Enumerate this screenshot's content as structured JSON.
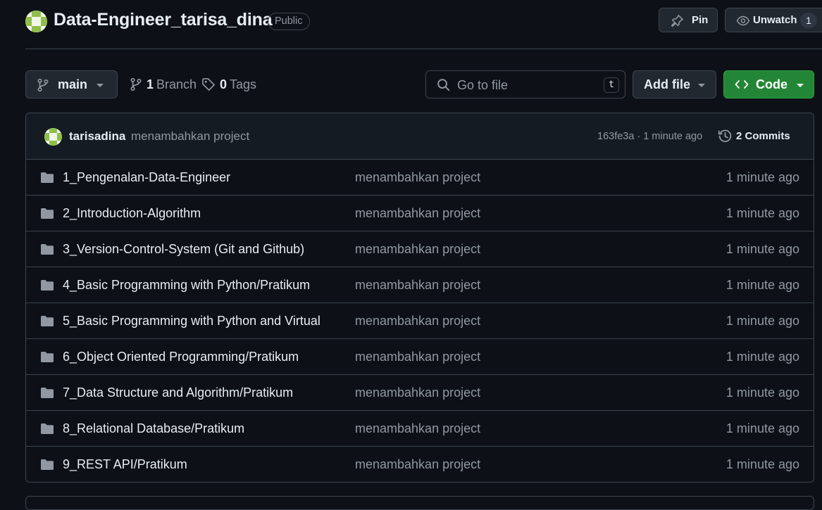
{
  "repo": {
    "name": "Data-Engineer_tarisa_dina",
    "visibility": "Public",
    "pin_label": "Pin",
    "watch_label": "Unwatch",
    "watch_count": "1"
  },
  "toolbar": {
    "branch": "main",
    "branches_count": "1",
    "branches_label": "Branch",
    "tags_count": "0",
    "tags_label": "Tags",
    "search_placeholder": "Go to file",
    "search_shortcut": "t",
    "add_file_label": "Add file",
    "code_label": "Code"
  },
  "latest_commit": {
    "author": "tarisadina",
    "message": "menambahkan project",
    "hash_time": "163fe3a · 1 minute ago",
    "commits_label": "2 Commits"
  },
  "files": [
    {
      "name": "1_Pengenalan-Data-Engineer",
      "message": "menambahkan project",
      "time": "1 minute ago"
    },
    {
      "name": "2_Introduction-Algorithm",
      "message": "menambahkan project",
      "time": "1 minute ago"
    },
    {
      "name": "3_Version-Control-System (Git and Github)",
      "message": "menambahkan project",
      "time": "1 minute ago"
    },
    {
      "name": "4_Basic Programming with Python/Pratikum",
      "message": "menambahkan project",
      "time": "1 minute ago"
    },
    {
      "name": "5_Basic Programming with Python and Virtual ...",
      "message": "menambahkan project",
      "time": "1 minute ago"
    },
    {
      "name": "6_Object Oriented Programming/Pratikum",
      "message": "menambahkan project",
      "time": "1 minute ago"
    },
    {
      "name": "7_Data Structure and Algorithm/Pratikum",
      "message": "menambahkan project",
      "time": "1 minute ago"
    },
    {
      "name": "8_Relational Database/Pratikum",
      "message": "menambahkan project",
      "time": "1 minute ago"
    },
    {
      "name": "9_REST API/Pratikum",
      "message": "menambahkan project",
      "time": "1 minute ago"
    }
  ],
  "colors": {
    "background": "#0d1117",
    "border": "#3d444d",
    "muted_text": "#9198a1",
    "primary_button": "#238636",
    "folder_icon": "#9198a1"
  }
}
